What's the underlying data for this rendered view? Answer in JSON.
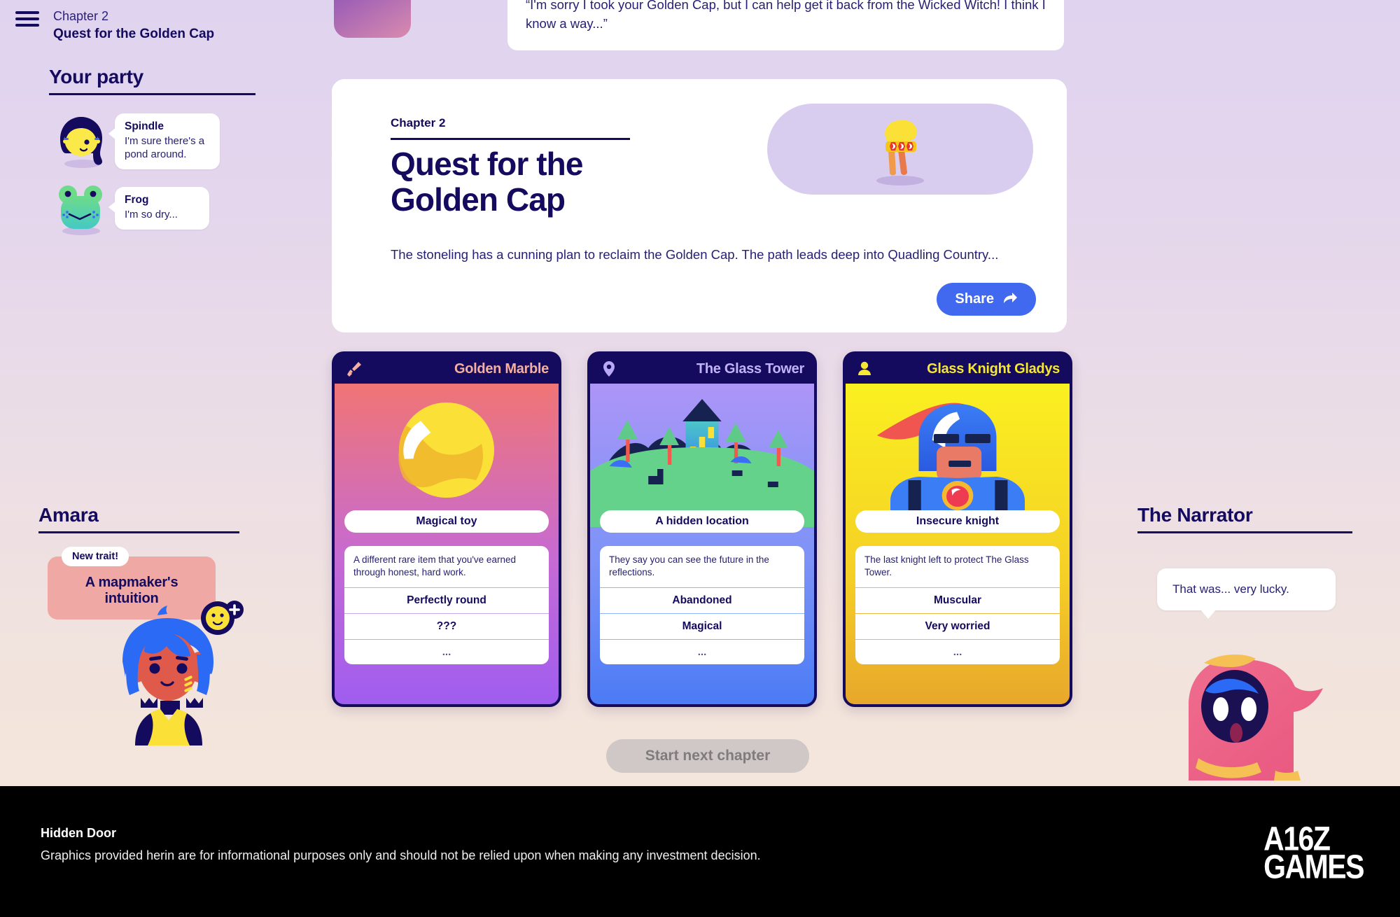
{
  "header": {
    "menu_icon": "hamburger-menu-icon",
    "chapter_label": "Chapter 2",
    "chapter_title": "Quest for the Golden Cap"
  },
  "party": {
    "heading": "Your party",
    "members": [
      {
        "name": "Spindle",
        "line": "I'm sure there's a pond around.",
        "avatar": "girl-dark-hair-avatar"
      },
      {
        "name": "Frog",
        "line": "I'm so dry...",
        "avatar": "frog-avatar"
      }
    ]
  },
  "stoneling": {
    "avatar": "stoneling-avatar",
    "speech": "“I'm sorry I took your Golden Cap, but I can help get it back from the Wicked Witch! I think I know a way...”"
  },
  "hero": {
    "chapter_label": "Chapter 2",
    "title": "Quest for the Golden Cap",
    "summary": "The stoneling has a cunning plan to reclaim the Golden Cap. The path leads deep into Quadling Country...",
    "artwork": "golden-cap-illustration",
    "share_label": "Share",
    "share_icon": "share-arrow-icon"
  },
  "cards": [
    {
      "title": "Golden Marble",
      "icon": "sword-icon",
      "icon_color": "#f3b0a0",
      "title_color": "#f3b0a0",
      "type": "Magical toy",
      "description": "A different rare item that you've earned through honest, hard work.",
      "stats": [
        "Perfectly round",
        "???"
      ],
      "more": "...",
      "artwork": "golden-marble-illustration",
      "divider_color": "#c9a6e8",
      "bg_top": "#f07575",
      "bg_bottom": "#9f5df0"
    },
    {
      "title": "The Glass Tower",
      "icon": "map-pin-icon",
      "icon_color": "#b9a8f5",
      "title_color": "#c2b2f7",
      "type": "A hidden location",
      "description": "They say you can see the future in the reflections.",
      "stats": [
        "Abandoned",
        "Magical"
      ],
      "more": "...",
      "artwork": "glass-tower-illustration",
      "divider_color": "#8fb4f8",
      "bg_top": "#ab92f7",
      "bg_bottom": "#4b7bf5"
    },
    {
      "title": "Glass Knight Gladys",
      "icon": "person-icon",
      "icon_color": "#f5e733",
      "title_color": "#f5e733",
      "type": "Insecure knight",
      "description": "The last knight left to protect The Glass Tower.",
      "stats": [
        "Muscular",
        "Very worried"
      ],
      "more": "...",
      "artwork": "glass-knight-illustration",
      "divider_color": "#edb942",
      "bg_top": "#faf020",
      "bg_bottom": "#e8a72c"
    }
  ],
  "start_button": {
    "label": "Start next chapter",
    "disabled": true
  },
  "amara": {
    "heading": "Amara",
    "trait_badge": "New trait!",
    "trait": "A mapmaker's intuition",
    "artwork": "amara-character-illustration"
  },
  "narrator": {
    "heading": "The Narrator",
    "speech": "That was... very lucky.",
    "artwork": "narrator-character-illustration"
  },
  "footer": {
    "title": "Hidden Door",
    "disclaimer": "Graphics provided herin are for informational purposes only and should not be relied upon when making any investment decision.",
    "logo_line1": "A16Z",
    "logo_line2": "GAMES"
  }
}
